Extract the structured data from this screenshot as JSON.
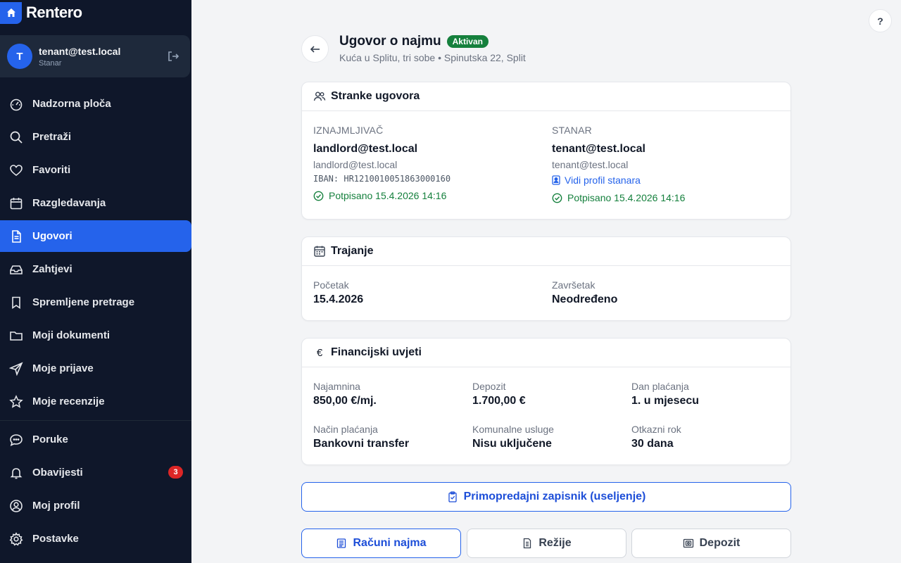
{
  "app": {
    "brand": "Rentero",
    "accent": "#2563eb",
    "sidebar_bg": "#0f172a"
  },
  "user": {
    "initial": "T",
    "email": "tenant@test.local",
    "role": "Stanar"
  },
  "nav": {
    "items": [
      {
        "label": "Nadzorna ploča",
        "icon": "gauge-icon"
      },
      {
        "label": "Pretraži",
        "icon": "search-icon"
      },
      {
        "label": "Favoriti",
        "icon": "heart-icon"
      },
      {
        "label": "Razgledavanja",
        "icon": "calendar-icon"
      },
      {
        "label": "Ugovori",
        "icon": "document-icon",
        "active": true
      },
      {
        "label": "Zahtjevi",
        "icon": "inbox-icon"
      },
      {
        "label": "Spremljene pretrage",
        "icon": "bookmark-icon"
      },
      {
        "label": "Moji dokumenti",
        "icon": "folder-icon"
      },
      {
        "label": "Moje prijave",
        "icon": "send-icon"
      },
      {
        "label": "Moje recenzije",
        "icon": "star-icon"
      }
    ],
    "secondary": [
      {
        "label": "Poruke",
        "icon": "chat-icon"
      },
      {
        "label": "Obavijesti",
        "icon": "bell-icon",
        "badge": "3"
      },
      {
        "label": "Moj profil",
        "icon": "user-icon"
      },
      {
        "label": "Postavke",
        "icon": "gear-icon"
      }
    ]
  },
  "help_label": "?",
  "header": {
    "title": "Ugovor o najmu",
    "status": "Aktivan",
    "subtitle": "Kuća u Splitu, tri sobe • Spinutska 22, Split"
  },
  "parties": {
    "title": "Stranke ugovora",
    "landlord": {
      "label": "IZNAJMLJIVAČ",
      "name": "landlord@test.local",
      "email": "landlord@test.local",
      "iban": "IBAN: HR1210010051863000160",
      "signed": "Potpisano 15.4.2026 14:16"
    },
    "tenant": {
      "label": "STANAR",
      "name": "tenant@test.local",
      "email": "tenant@test.local",
      "profile_link": "Vidi profil stanara",
      "signed": "Potpisano 15.4.2026 14:16"
    }
  },
  "duration": {
    "title": "Trajanje",
    "start_label": "Početak",
    "start_value": "15.4.2026",
    "end_label": "Završetak",
    "end_value": "Neodređeno"
  },
  "finance": {
    "title": "Financijski uvjeti",
    "currency_symbol": "€",
    "fields": [
      {
        "label": "Najamnina",
        "value": "850,00 €/mj."
      },
      {
        "label": "Depozit",
        "value": "1.700,00 €"
      },
      {
        "label": "Dan plaćanja",
        "value": "1. u mjesecu"
      },
      {
        "label": "Način plaćanja",
        "value": "Bankovni transfer"
      },
      {
        "label": "Komunalne usluge",
        "value": "Nisu uključene"
      },
      {
        "label": "Otkazni rok",
        "value": "30 dana"
      }
    ]
  },
  "actions": {
    "handover": "Primopredajni zapisnik (useljenje)",
    "tabs": [
      {
        "label": "Računi najma",
        "icon": "receipt-icon",
        "active": true
      },
      {
        "label": "Režije",
        "icon": "bill-icon"
      },
      {
        "label": "Depozit",
        "icon": "safe-icon"
      }
    ]
  }
}
